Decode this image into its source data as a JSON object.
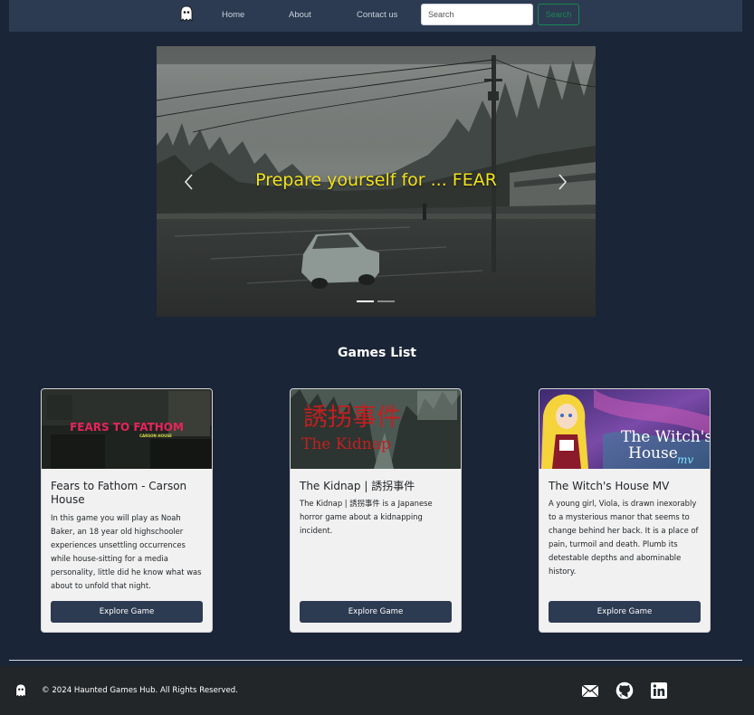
{
  "navbar": {
    "logo_icon": "ghost-icon",
    "links": [
      {
        "label": "Home"
      },
      {
        "label": "About"
      },
      {
        "label": "Contact us"
      }
    ],
    "search": {
      "placeholder": "Search",
      "value": "",
      "button_label": "Search"
    }
  },
  "carousel": {
    "caption": "Prepare yourself for ... FEAR",
    "prev_icon": "chevron-left-icon",
    "next_icon": "chevron-right-icon",
    "slide_count": 2,
    "active_slide": 1
  },
  "games_section": {
    "title": "Games List",
    "cards": [
      {
        "image_text_main": "FEARS TO FATHOM",
        "image_text_sub": "CARSON HOUSE",
        "title": "Fears to Fathom - Carson House",
        "description": "In this game you will play as Noah Baker, an 18 year old highschooler experiences unsettling occurrences while house-sitting for a media personality, little did he know what was about to unfold that night.",
        "button_label": "Explore Game"
      },
      {
        "image_text_main": "誘拐事件",
        "image_text_sub": "The Kidnap",
        "title": "The Kidnap | 誘拐事件",
        "description": "The Kidnap | 誘拐事件 is a Japanese horror game about a kidnapping incident.",
        "button_label": "Explore Game"
      },
      {
        "image_text_main": "The Witch's",
        "image_text_sub": "House",
        "image_text_tag": "mv",
        "title": "The Witch's House MV",
        "description": "A young girl, Viola, is drawn inexorably to a mysterious manor that seems to change behind her back. It is a place of pain, turmoil and death. Plumb its detestable depths and abominable history.",
        "button_label": "Explore Game"
      }
    ]
  },
  "footer": {
    "logo_icon": "ghost-icon",
    "copyright": "© 2024 Haunted Games Hub. All Rights Reserved.",
    "social_icons": [
      "mail-icon",
      "github-icon",
      "linkedin-icon"
    ]
  },
  "colors": {
    "background": "#1b2538",
    "navbar": "#2c3b51",
    "accent_green": "#198754",
    "caption_yellow": "#f2e21c",
    "footer": "#232629",
    "button": "#2c3b51"
  }
}
